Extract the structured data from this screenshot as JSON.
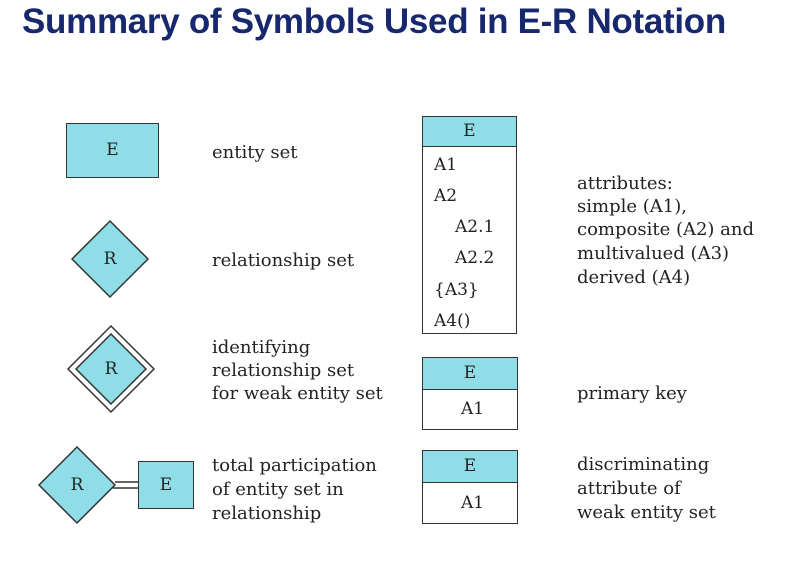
{
  "title": "Summary of Symbols Used in E-R Notation",
  "colors": {
    "fill": "#8fdde6",
    "title": "#18286e",
    "stroke": "#333333"
  },
  "left_symbols": {
    "entity": {
      "symbol": "E",
      "label": "entity set"
    },
    "relationship": {
      "symbol": "R",
      "label": "relationship set"
    },
    "identifying": {
      "symbol": "R",
      "label_lines": [
        "identifying",
        "relationship set",
        "for weak entity set"
      ]
    },
    "total": {
      "symbol_r": "R",
      "symbol_e": "E",
      "label_lines": [
        "total participation",
        "of entity set in",
        "relationship"
      ]
    }
  },
  "attributes_box": {
    "header": "E",
    "items": [
      "A1",
      "A2",
      "A2.1",
      "A2.2",
      "{A3}",
      "A4()"
    ],
    "label_lines": [
      "attributes:",
      "simple (A1),",
      "composite (A2) and",
      "multivalued (A3)",
      "derived (A4)"
    ]
  },
  "primary_key": {
    "header": "E",
    "attr": "A1",
    "label": "primary key"
  },
  "discriminator": {
    "header": "E",
    "attr": "A1",
    "label_lines": [
      "discriminating",
      "attribute of",
      "weak entity set"
    ]
  }
}
